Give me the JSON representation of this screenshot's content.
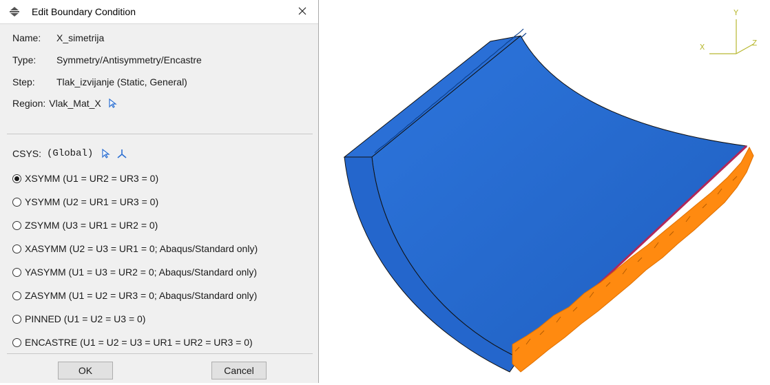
{
  "dialog": {
    "title": "Edit Boundary Condition",
    "name_label": "Name:",
    "name_value": "X_simetrija",
    "type_label": "Type:",
    "type_value": "Symmetry/Antisymmetry/Encastre",
    "step_label": "Step:",
    "step_value": "Tlak_izvijanje (Static, General)",
    "region_label": "Region:",
    "region_value": "Vlak_Mat_X",
    "csys_label": "CSYS:",
    "csys_value": "(Global)",
    "options": [
      {
        "label": "XSYMM (U1 = UR2 = UR3 = 0)",
        "selected": true
      },
      {
        "label": "YSYMM (U2 = UR1 = UR3 = 0)",
        "selected": false
      },
      {
        "label": "ZSYMM (U3 = UR1 = UR2 = 0)",
        "selected": false
      },
      {
        "label": "XASYMM (U2 = U3 = UR1 = 0; Abaqus/Standard only)",
        "selected": false
      },
      {
        "label": "YASYMM (U1 = U3 = UR2 = 0; Abaqus/Standard only)",
        "selected": false
      },
      {
        "label": "ZASYMM (U1 = U2 = UR3 = 0; Abaqus/Standard only)",
        "selected": false
      },
      {
        "label": "PINNED (U1 = U2 = U3 = 0)",
        "selected": false
      },
      {
        "label": "ENCASTRE (U1 = U2 = U3 = UR1 = UR2 = UR3 = 0)",
        "selected": false
      }
    ],
    "ok_label": "OK",
    "cancel_label": "Cancel"
  },
  "viewport": {
    "axes": {
      "x": "X",
      "y": "Y",
      "z": "Z"
    },
    "colors": {
      "part": "#2a6fd6",
      "part_dark": "#1d57b0",
      "bc_marker": "#ff8a10",
      "edge": "#111111",
      "triad": "#b8b830"
    }
  },
  "icons": {
    "app": "boundary-condition-icon",
    "close": "close-icon",
    "region_select": "select-arrow-icon",
    "csys_select": "select-arrow-icon",
    "csys_create": "csys-triad-icon"
  }
}
